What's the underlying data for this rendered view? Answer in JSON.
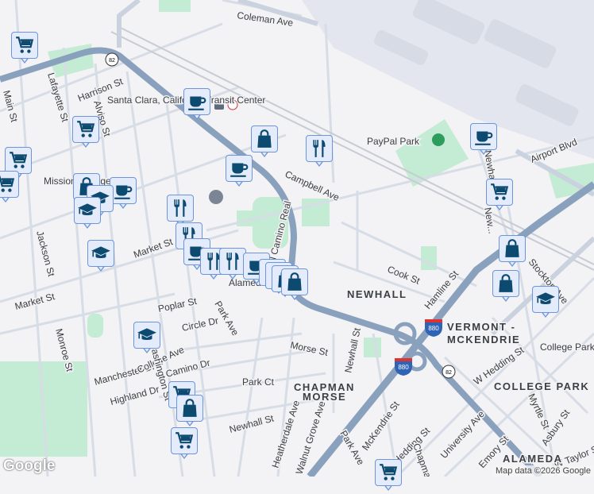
{
  "map": {
    "streets": [
      "Coleman Ave",
      "Harrison St",
      "Lafayette St",
      "Alviso St",
      "Main St",
      "Jackson St",
      "Market St",
      "Market St",
      "Monroe St",
      "Poplar St",
      "Circle Dr",
      "Park Ave",
      "Campbell Ave",
      "El Camino Real",
      "Cook St",
      "Hamline St",
      "Newhall St",
      "Morse St",
      "Newhall Dr",
      "Stockton Ave",
      "W Hedding St",
      "Myrtle St",
      "Asbury St",
      "University Ave",
      "Emory St",
      "McKendrie St",
      "Hedding St",
      "Park Ave",
      "Walnut Grove Ave",
      "Heatherdale Ave",
      "Newhall St",
      "Park Ct",
      "Manchester Dr",
      "College Ave",
      "Camino Dr",
      "Highland Dr",
      "Washington St",
      "Airport Blvd",
      "W Taylor St",
      "Alameda",
      "Chapman St",
      "New..."
    ],
    "places": [
      "Santa Clara, California Transit Center",
      "PayPal Park",
      "Mission College Clara",
      "College Park"
    ],
    "neighborhoods": [
      "NEWHALL",
      "VERMONT -",
      "MCKENDRIE",
      "CHAPMAN",
      "MORSE",
      "COLLEGE PARK",
      "ALAMEDA"
    ],
    "shields": [
      "82",
      "82",
      "880",
      "880"
    ],
    "markers": [
      {
        "type": "cart"
      },
      {
        "type": "coffee"
      },
      {
        "type": "bag"
      },
      {
        "type": "dining"
      },
      {
        "type": "coffee"
      },
      {
        "type": "coffee"
      },
      {
        "type": "cart"
      },
      {
        "type": "cart"
      },
      {
        "type": "cart"
      },
      {
        "type": "bag"
      },
      {
        "type": "coffee"
      },
      {
        "type": "school"
      },
      {
        "type": "school"
      },
      {
        "type": "dining"
      },
      {
        "type": "dining"
      },
      {
        "type": "school"
      },
      {
        "type": "coffee"
      },
      {
        "type": "dining"
      },
      {
        "type": "dining"
      },
      {
        "type": "coffee"
      },
      {
        "type": "bag"
      },
      {
        "type": "bag"
      },
      {
        "type": "bag"
      },
      {
        "type": "bag"
      },
      {
        "type": "cart"
      },
      {
        "type": "bag"
      },
      {
        "type": "bag"
      },
      {
        "type": "school"
      },
      {
        "type": "school"
      },
      {
        "type": "cart"
      },
      {
        "type": "bag"
      },
      {
        "type": "cart"
      },
      {
        "type": "cart"
      }
    ],
    "attribution": "Map data ©2026 Google",
    "logo": "Google"
  }
}
